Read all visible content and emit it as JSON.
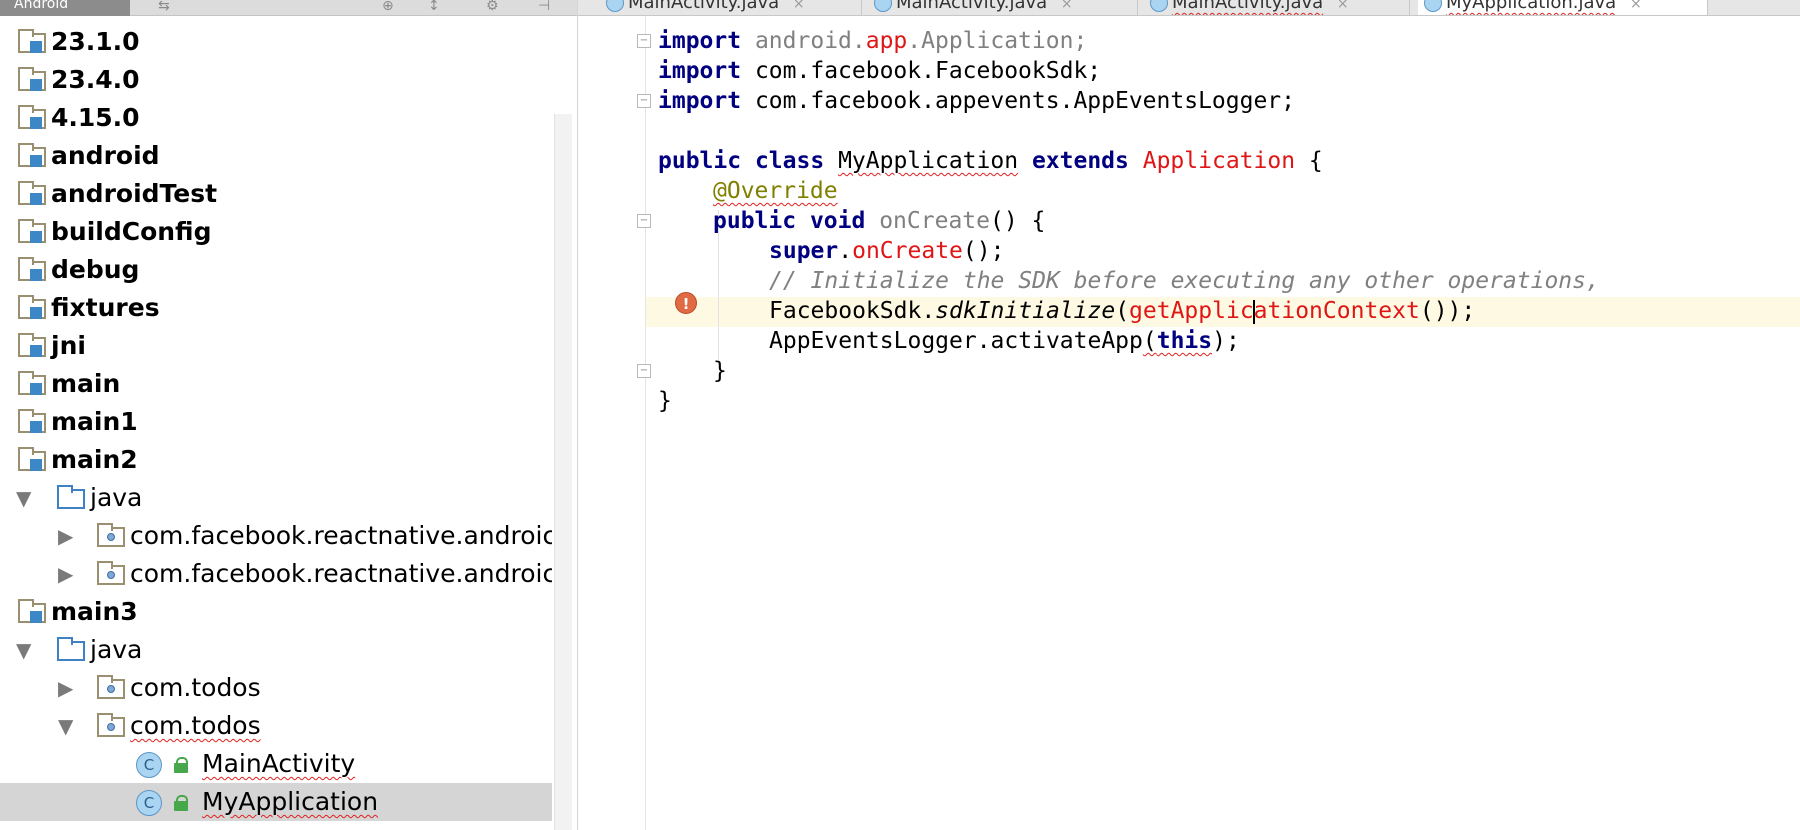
{
  "colors": {
    "keyword": "#000080",
    "error": "#e01515",
    "annotation": "#808000",
    "comment": "#808080",
    "current_line": "#fdf9e3",
    "selection": "#d5d5d5"
  },
  "project_panel": {
    "view_selector": "Android",
    "tree": [
      {
        "label": "23.1.0",
        "icon": "folder-icon"
      },
      {
        "label": "23.4.0",
        "icon": "folder-icon"
      },
      {
        "label": "4.15.0",
        "icon": "folder-icon"
      },
      {
        "label": "android",
        "icon": "folder-icon"
      },
      {
        "label": "androidTest",
        "icon": "folder-icon"
      },
      {
        "label": "buildConfig",
        "icon": "folder-icon"
      },
      {
        "label": "debug",
        "icon": "folder-icon"
      },
      {
        "label": "fixtures",
        "icon": "folder-icon"
      },
      {
        "label": "jni",
        "icon": "folder-icon"
      },
      {
        "label": "main",
        "icon": "folder-icon"
      },
      {
        "label": "main1",
        "icon": "folder-icon"
      },
      {
        "label": "main2",
        "icon": "folder-icon"
      },
      {
        "label": "java",
        "icon": "source-folder-icon",
        "expanded": true
      },
      {
        "label": "com.facebook.reactnative.androic",
        "icon": "package-icon",
        "expanded": false
      },
      {
        "label": "com.facebook.reactnative.androic",
        "icon": "package-icon",
        "expanded": false
      },
      {
        "label": "main3",
        "icon": "folder-icon"
      },
      {
        "label": "java",
        "icon": "source-folder-icon",
        "expanded": true
      },
      {
        "label": "com.todos",
        "icon": "package-icon",
        "expanded": false
      },
      {
        "label": "com.todos",
        "icon": "package-icon",
        "expanded": true
      },
      {
        "label": "MainActivity",
        "icon": "class-icon",
        "class_letter": "C"
      },
      {
        "label": "MyApplication",
        "icon": "class-icon",
        "class_letter": "C",
        "selected": true
      }
    ]
  },
  "editor": {
    "tabs": [
      {
        "label": "MainActivity.java"
      },
      {
        "label": "MainActivity.java"
      },
      {
        "label": "MainActivity.java"
      },
      {
        "label": "MyApplication.java",
        "active": true
      }
    ],
    "tab_close": "×",
    "code": {
      "kw_import": "import",
      "kw_public": "public",
      "kw_class": "class",
      "kw_extends": "extends",
      "kw_void": "void",
      "kw_super": "super",
      "kw_this": "this",
      "import1_pre": "android.",
      "import1_app": "app",
      "import1_post": ".Application;",
      "import2": "com.facebook.FacebookSdk;",
      "import3": "com.facebook.appevents.AppEventsLogger;",
      "class_name": "MyApplication",
      "parent_class": "Application",
      "open_brace": "{",
      "close_brace": "}",
      "override": "@Override",
      "method_name": "onCreate",
      "method_sig_tail": "() {",
      "super_call": "onCreate",
      "call_tail": "();",
      "comment": "// Initialize the SDK before executing any other operations,",
      "sdk_obj": "FacebookSdk.",
      "sdk_method": "sdkInitialize",
      "open_paren": "(",
      "ctx_before_caret": "getApplic",
      "ctx_after_caret": "ationContext",
      "sdk_tail": "());",
      "logger_call": "AppEventsLogger.activateApp",
      "logger_open": "(",
      "logger_tail": ");",
      "dot": ".",
      "space": " "
    },
    "intention_bulb": "!"
  }
}
